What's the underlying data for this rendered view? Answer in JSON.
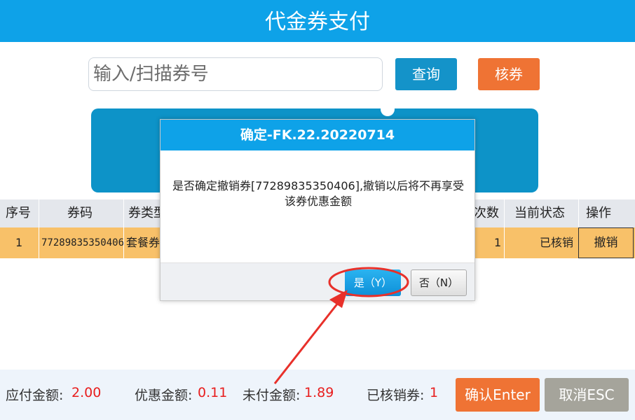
{
  "title": "代金券支付",
  "search": {
    "placeholder": "输入/扫描券号",
    "query_label": "查询",
    "verify_label": "核券"
  },
  "table": {
    "headers": [
      "序号",
      "券码",
      "券类型",
      "次数",
      "当前状态",
      "操作"
    ],
    "row": {
      "index": "1",
      "code": "77289835350406",
      "type": "套餐券",
      "count": "1",
      "status": "已核销",
      "action": "撤销"
    }
  },
  "dialog": {
    "title": "确定-FK.22.20220714",
    "message": "是否确定撤销券[77289835350406],撤销以后将不再享受该券优惠金额",
    "yes_label": "是（Y）",
    "no_label": "否（N）"
  },
  "footer": {
    "payable_label": "应付金额:",
    "payable_value": "2.00",
    "discount_label": "优惠金额:",
    "discount_value": "0.11",
    "unpaid_label": "未付金额:",
    "unpaid_value": "1.89",
    "verified_label": "已核销券:",
    "verified_value": "1",
    "confirm_label": "确认Enter",
    "cancel_label": "取消ESC"
  },
  "colors": {
    "primary": "#0ea2e8",
    "accent": "#ef7334",
    "row_highlight": "#f8c169",
    "value_red": "#e81e1e",
    "annotation": "#e8302a"
  }
}
